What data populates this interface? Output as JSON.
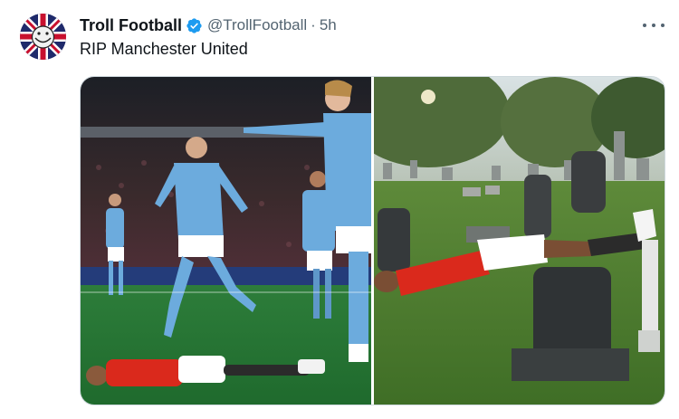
{
  "tweet": {
    "display_name": "Troll Football",
    "handle": "@TrollFootball",
    "separator": "·",
    "time": "5h",
    "text": "RIP Manchester United",
    "verified": true
  },
  "icons": {
    "avatar": "union-jack-troll-face-avatar",
    "verified": "verified-badge-icon",
    "more": "more-horizontal-icon"
  },
  "colors": {
    "verified_blue": "#1d9bf0",
    "secondary_text": "#536471",
    "man_city_blue": "#6cabdd",
    "man_utd_red": "#da291c"
  }
}
